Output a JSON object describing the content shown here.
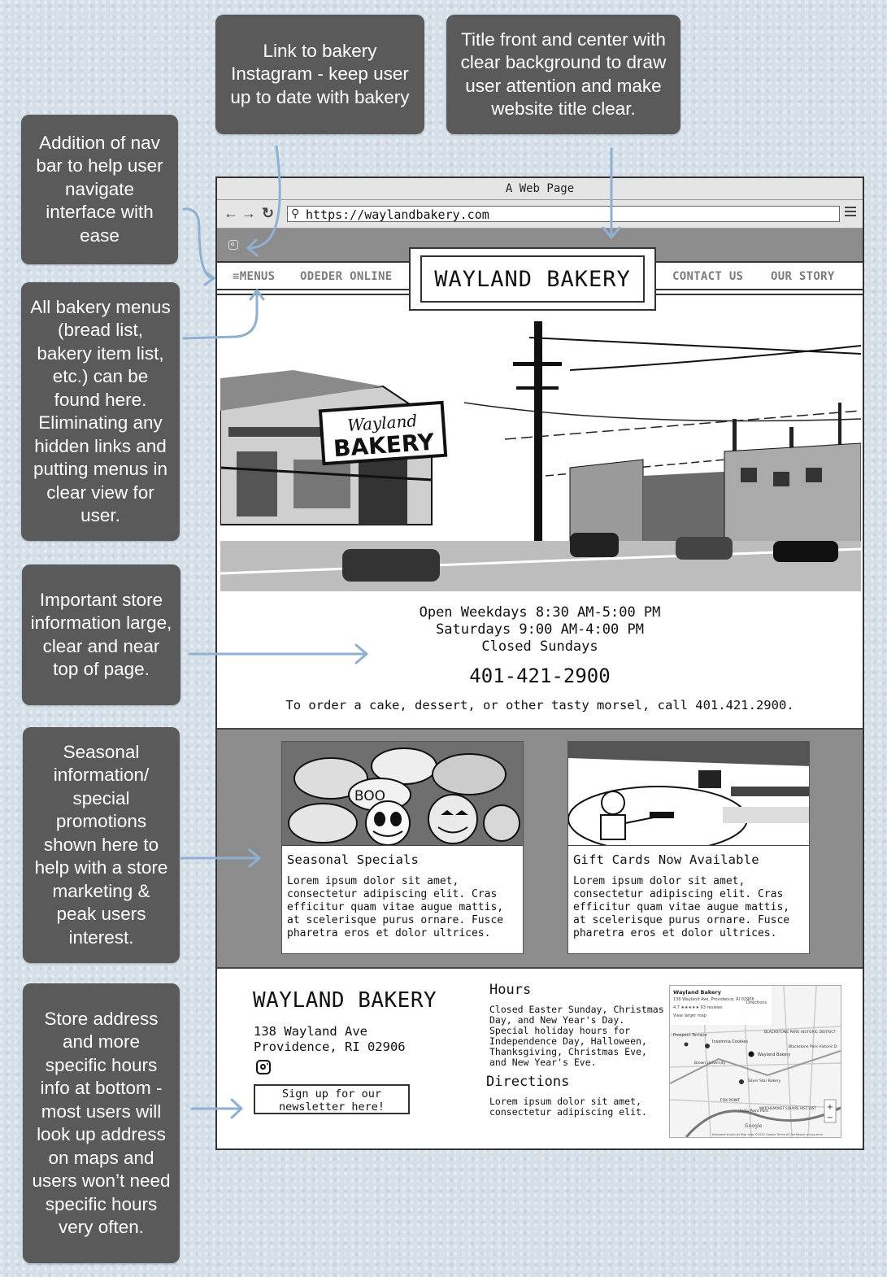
{
  "annotations": {
    "instagram": "Link to bakery Instagram - keep user up to date with bakery",
    "title": "Title front and center with clear background to draw user attention and make website title clear.",
    "navbar": "Addition of nav bar to help user navigate interface with ease",
    "menus": "All bakery menus (bread list, bakery item list, etc.) can be found here. Eliminating any hidden links and putting menus in clear view for user.",
    "store_info": "Important store information large, clear and near top of page.",
    "seasonal": "Seasonal information/ special promotions shown here to help with a store marketing & peak users interest.",
    "address": "Store address and more specific hours info at bottom - most users will look up address on maps and users won’t need specific hours very often."
  },
  "browser": {
    "window_title": "A Web Page",
    "url": "https://waylandbakery.com"
  },
  "nav": {
    "menus": "MENUS",
    "order_online": "ODEDER ONLINE",
    "site_title": "WAYLAND BAKERY",
    "contact": "CONTACT US",
    "story": "OUR STORY"
  },
  "hero": {
    "sign_line1": "Wayland",
    "sign_line2": "BAKERY"
  },
  "store_info": {
    "hours_weekdays": "Open Weekdays 8:30 AM-5:00 PM",
    "hours_saturday": "Saturdays 9:00 AM-4:00 PM",
    "hours_sunday": "Closed Sundays",
    "phone": "401-421-2900",
    "order_text": "To order a cake, dessert, or other tasty morsel, call 401.421.2900."
  },
  "promos": [
    {
      "title": "Seasonal Specials",
      "image_text": "BOO",
      "body": "Lorem ipsum dolor sit amet, consectetur adipiscing elit. Cras efficitur quam vitae augue mattis, at scelerisque purus ornare. Fusce pharetra eros et dolor ultrices."
    },
    {
      "title": "Gift Cards Now Available",
      "body": "Lorem ipsum dolor sit amet, consectetur adipiscing elit. Cras efficitur quam vitae augue mattis, at scelerisque purus ornare. Fusce pharetra eros et dolor ultrices."
    }
  ],
  "footer": {
    "title": "WAYLAND BAKERY",
    "address_line1": "138 Wayland Ave",
    "address_line2": "Providence, RI 02906",
    "newsletter": "Sign up for our newsletter here!",
    "hours_heading": "Hours",
    "hours_text": "Closed Easter Sunday, Christmas Day, and New Year's Day. Special holiday hours for Independence Day, Halloween, Thanksgiving, Christmas Eve, and New Year's Eve.",
    "directions_heading": "Directions",
    "directions_text": "Lorem ipsum dolor sit amet, consectetur adipiscing elit."
  },
  "map": {
    "place_name": "Wayland Bakery",
    "place_address": "138 Wayland Ave, Providence, RI 02906",
    "rating": "4.7 ★★★★★ 93 reviews",
    "view_larger": "View larger map",
    "directions": "Directions",
    "labels": [
      "Prospect Terrace",
      "Insomnia Cookies",
      "BLACKSTONE PARK HISTORIC DISTRICT",
      "Blackstone Park Historic D",
      "Brown University",
      "Wayland Bakery",
      "Silver Star Bakery",
      "FOX POINT",
      "India Point Park",
      "WATCHEMOKET SQUARE HIST DIST",
      "Google"
    ],
    "zoom_in": "+",
    "zoom_out": "−",
    "footer_text": "Keyboard shortcuts   Map data ©2022 Google   Terms of Use   Report a map error"
  },
  "colors": {
    "note_bg": "#5a5a5a",
    "arrow": "#8fb0d0",
    "band": "#8c8c8c"
  }
}
